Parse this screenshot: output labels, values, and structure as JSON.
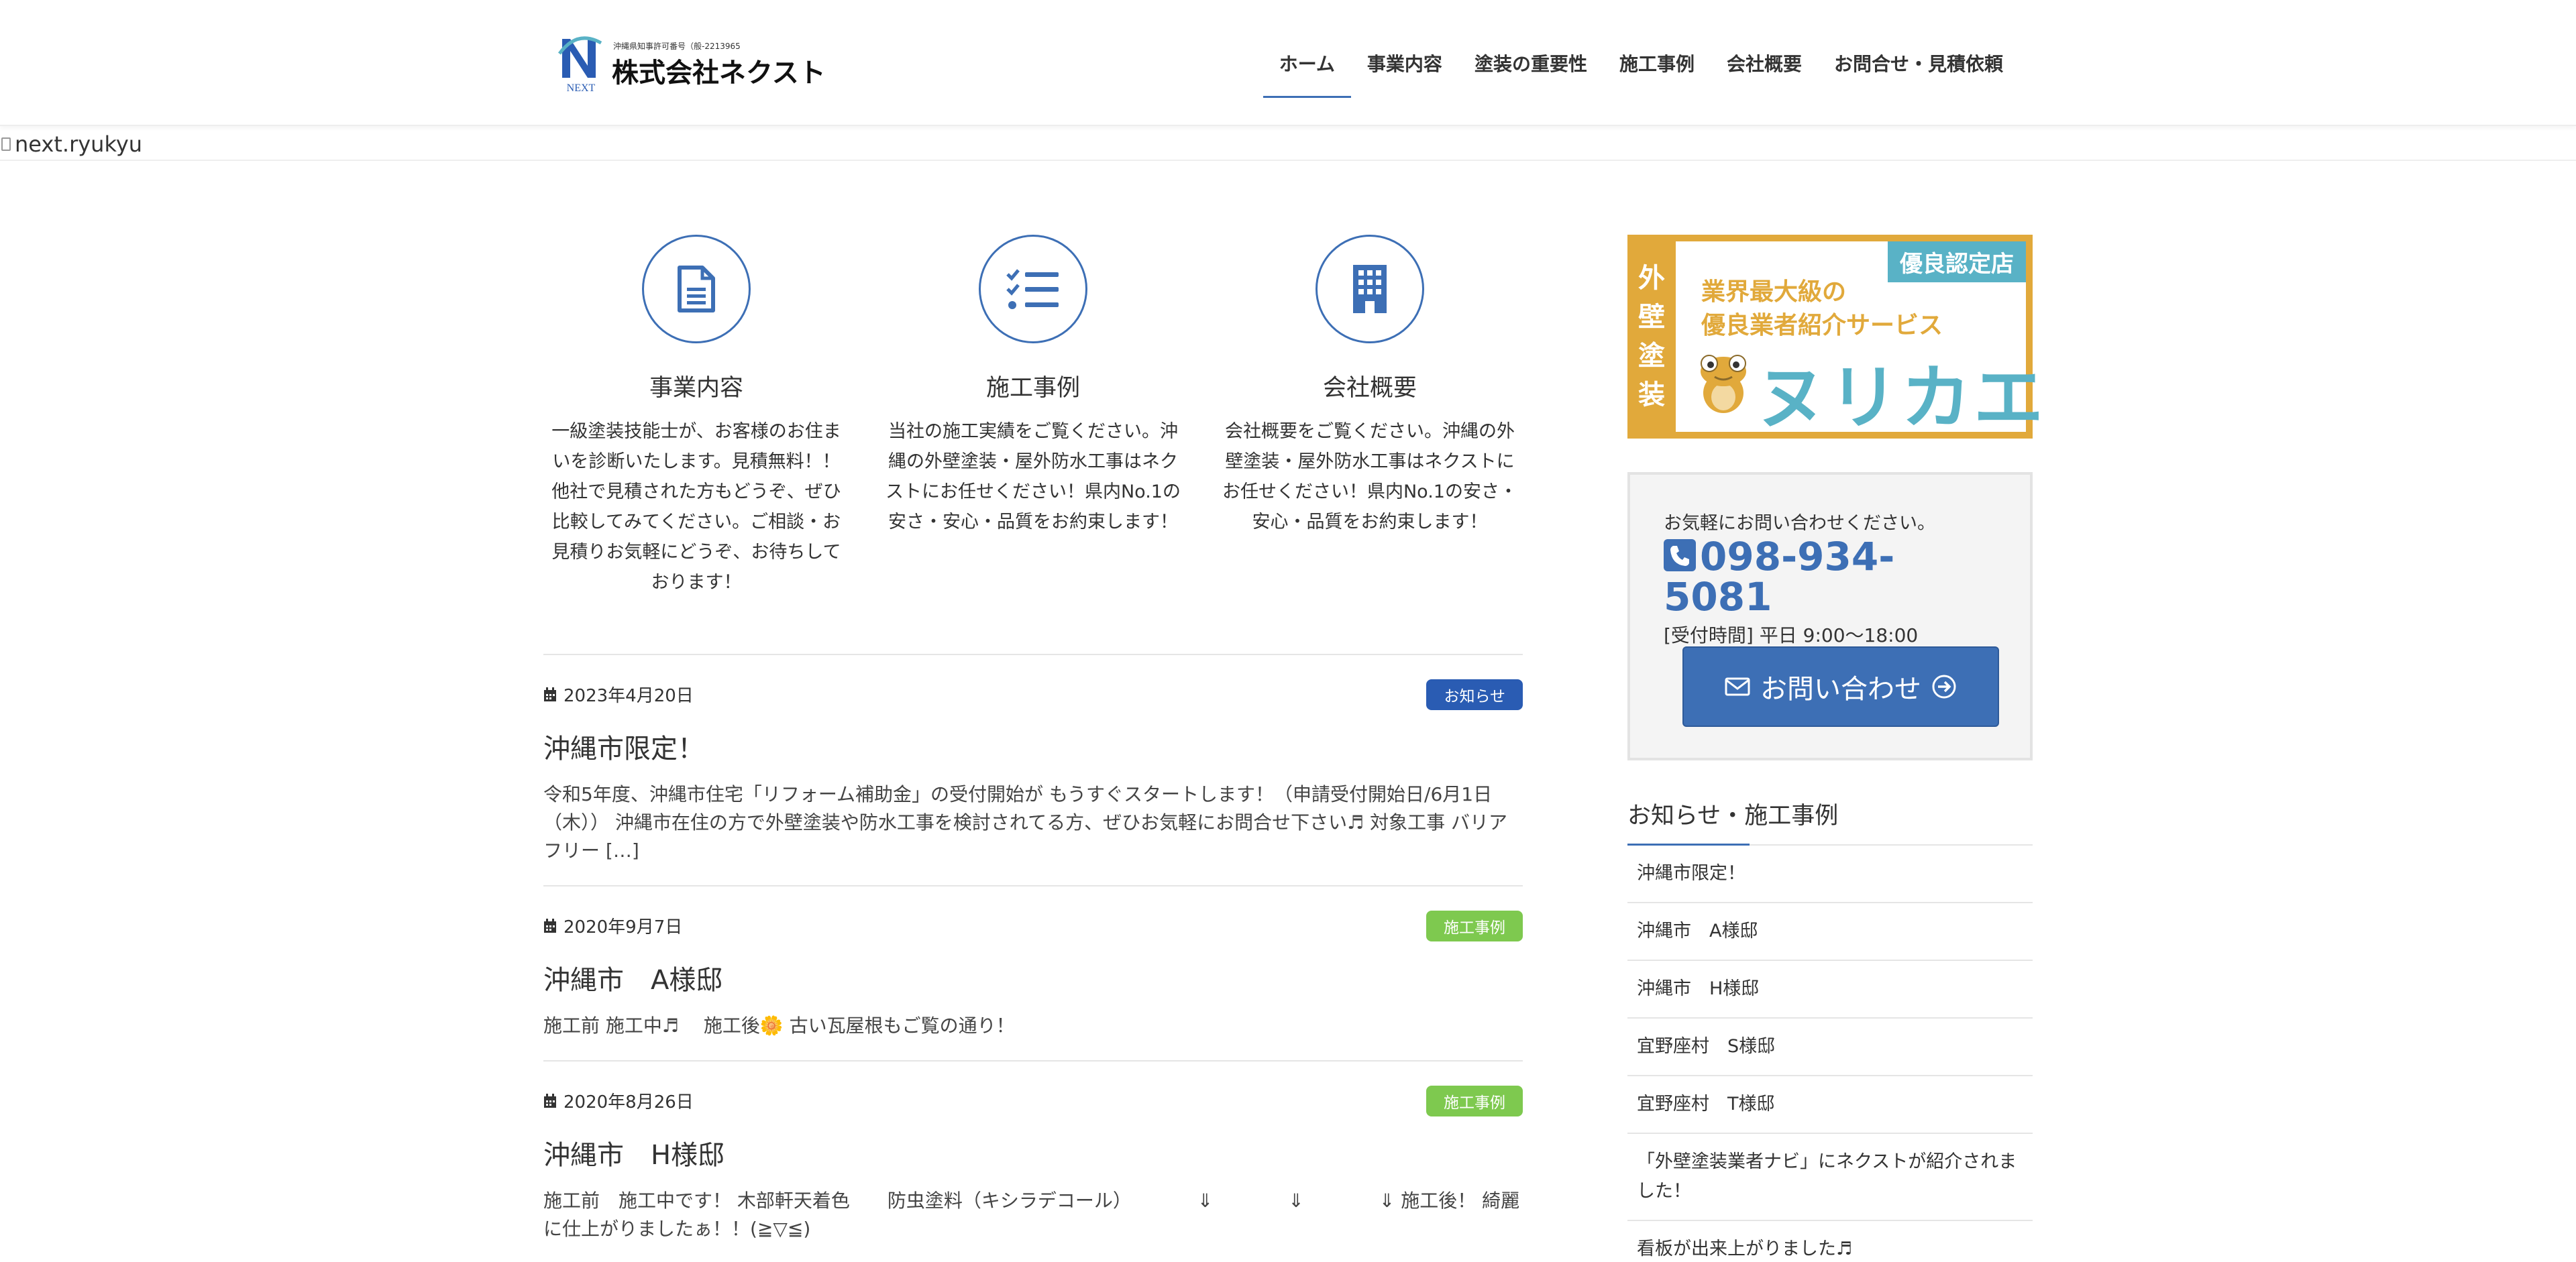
{
  "header": {
    "logo_small": "沖縄県知事許可番号（般-2213965",
    "logo_company": "株式会社ネクスト",
    "logo_mark_text": "NEXT",
    "nav": [
      {
        "label": "ホーム",
        "active": true
      },
      {
        "label": "事業内容"
      },
      {
        "label": "塗装の重要性"
      },
      {
        "label": "施工事例"
      },
      {
        "label": "会社概要"
      },
      {
        "label": "お問合せ・見積依頼"
      }
    ]
  },
  "hero": {
    "alt_text": "next.ryukyu"
  },
  "features": [
    {
      "icon": "document-icon",
      "title": "事業内容",
      "text": "一級塗装技能士が、お客様のお住まいを診断いたします。見積無料！！他社で見積された方もどうぞ、ぜひ比較してみてください。ご相談・お見積りお気軽にどうぞ、お待ちしております！"
    },
    {
      "icon": "checklist-icon",
      "title": "施工事例",
      "text": "当社の施工実績をご覧ください。沖縄の外壁塗装・屋外防水工事はネクストにお任せください！県内No.1の安さ・安心・品質をお約束します！"
    },
    {
      "icon": "building-icon",
      "title": "会社概要",
      "text": "会社概要をご覧ください。沖縄の外壁塗装・屋外防水工事はネクストにお任せください！県内No.1の安さ・安心・品質をお約束します！"
    }
  ],
  "posts": [
    {
      "date": "2023年4月20日",
      "badge": "お知らせ",
      "badge_color": "#2a5cb3",
      "title": "沖縄市限定！",
      "excerpt": "令和5年度、沖縄市住宅「リフォーム補助金」の受付開始が もうすぐスタートします！（申請受付開始日/6月1日（木）） 沖縄市在住の方で外壁塗装や防水工事を検討されてる方、ぜひお気軽にお問合せ下さい♬ 対象工事 バリアフリー […]"
    },
    {
      "date": "2020年9月7日",
      "badge": "施工事例",
      "badge_color": "#7ec94f",
      "title": "沖縄市　A様邸",
      "excerpt": "施工前 施工中♬　 施工後🌼 古い瓦屋根もご覧の通り！"
    },
    {
      "date": "2020年8月26日",
      "badge": "施工事例",
      "badge_color": "#7ec94f",
      "title": "沖縄市　H様邸",
      "excerpt": "施工前　施工中です！ 木部軒天着色　　防虫塗料（キシラデコール）　　　　⇓　　　　⇓　　　　⇓ 施工後！ 綺麗に仕上がりましたぁ！！(≧▽≦)"
    }
  ],
  "sidebar": {
    "banner": {
      "side_text": [
        "外",
        "壁",
        "塗",
        "装"
      ],
      "ribbon": "優良認定店",
      "line1": "業界最大級の",
      "line2": "優良業者紹介サービス",
      "brand": "ヌリカエ"
    },
    "contact": {
      "lead": "お気軽にお問い合わせください。",
      "phone": "098-934-5081",
      "hours": "[受付時間] 平日 9:00〜18:00",
      "button_label": "お問い合わせ"
    },
    "widget_title": "お知らせ・施工事例",
    "widget_items": [
      "沖縄市限定！",
      "沖縄市　A様邸",
      "沖縄市　H様邸",
      "宜野座村　S様邸",
      "宜野座村　T様邸",
      "「外壁塗装業者ナビ」にネクストが紹介されました！",
      "看板が出来上がりました♬"
    ]
  },
  "colors": {
    "accent": "#3d6fb5",
    "banner_gold": "#e1a93b",
    "banner_teal": "#59b2c6"
  }
}
